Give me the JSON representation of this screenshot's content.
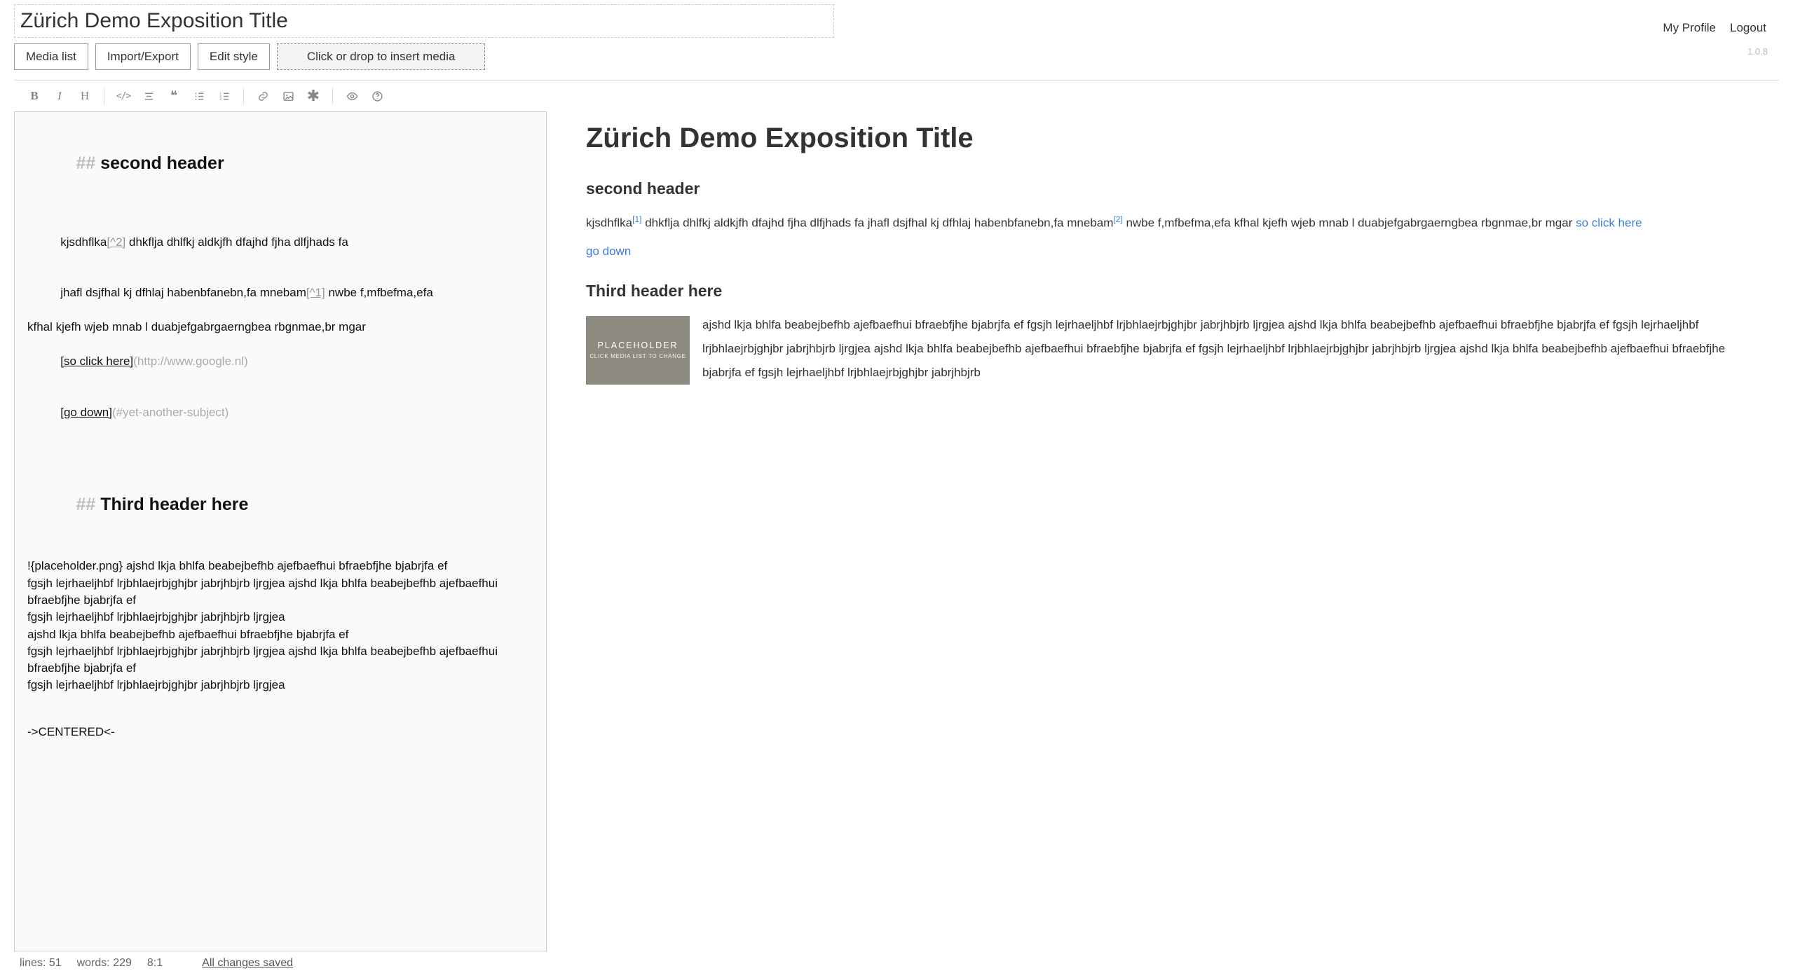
{
  "header": {
    "title_value": "Zürich Demo Exposition Title",
    "nav": {
      "profile": "My Profile",
      "logout": "Logout"
    },
    "version": "1.0.8",
    "buttons": {
      "media_list": "Media list",
      "import_export": "Import/Export",
      "edit_style": "Edit style"
    },
    "dropzone": "Click or drop to insert media"
  },
  "toolbar": {
    "bold": "B",
    "italic": "I",
    "header": "H",
    "code_open": "<",
    "code_close": "/>",
    "quote": "❝"
  },
  "editor": {
    "h2a_prefix": "## ",
    "h2a_text": "second header",
    "p1_l1a": "kjsdhflka",
    "p1_l1_fn": "[^2]",
    "p1_l1b": " dhkflja dhlfkj aldkjfh dfajhd fjha dlfjhads fa",
    "p1_l2a": "jhafl dsjfhal kj dfhlaj habenbfanebn,fa mnebam",
    "p1_l2_fn": "[^1]",
    "p1_l2b": " nwbe f,mfbefma,efa",
    "p1_l3": "kfhal kjefh wjeb mnab l duabjefgabrgaerngbea rbgnmae,br mgar",
    "link1_text": "[so click here]",
    "link1_url": "(http://www.google.nl)",
    "link2_text": "[go down]",
    "link2_url": "(#yet-another-subject)",
    "h2b_prefix": "## ",
    "h2b_text": "Third header here",
    "p2_l1": "!{placeholder.png} ajshd lkja bhlfa beabejbefhb ajefbaefhui bfraebfjhe bjabrjfa ef",
    "p2_l2": "fgsjh lejrhaeljhbf lrjbhlaejrbjghjbr jabrjhbjrb ljrgjea ajshd lkja bhlfa beabejbefhb ajefbaefhui bfraebfjhe bjabrjfa ef",
    "p2_l3": "fgsjh lejrhaeljhbf lrjbhlaejrbjghjbr jabrjhbjrb ljrgjea",
    "p2_l4": "ajshd lkja bhlfa beabejbefhb ajefbaefhui bfraebfjhe bjabrjfa ef",
    "p2_l5": "fgsjh lejrhaeljhbf lrjbhlaejrbjghjbr jabrjhbjrb ljrgjea ajshd lkja bhlfa beabejbefhb ajefbaefhui bfraebfjhe bjabrjfa ef",
    "p2_l6": "fgsjh lejrhaeljhbf lrjbhlaejrbjghjbr jabrjhbjrb ljrgjea",
    "p3": "->CENTERED<-"
  },
  "statusbar": {
    "lines_label": "lines:",
    "lines_value": "51",
    "words_label": "words:",
    "words_value": "229",
    "cursor": "8:1",
    "saved": "All changes saved"
  },
  "preview": {
    "title": "Zürich Demo Exposition Title",
    "h2a": "second header",
    "p1_a": "kjsdhflka",
    "p1_fn1": "[1]",
    "p1_b": " dhkflja dhlfkj aldkjfh dfajhd fjha dlfjhads fa jhafl dsjfhal kj dfhlaj habenbfanebn,fa mnebam",
    "p1_fn2": "[2]",
    "p1_c": " nwbe f,mfbefma,efa kfhal kjefh wjeb mnab l duabjefgabrgaerngbea rbgnmae,br mgar ",
    "link1": "so click here",
    "link2": "go down",
    "h2b": "Third header here",
    "placeholder_title": "PLACEHOLDER",
    "placeholder_sub": "CLICK MEDIA LIST TO CHANGE",
    "p2": "ajshd lkja bhlfa beabejbefhb ajefbaefhui bfraebfjhe bjabrjfa ef fgsjh lejrhaeljhbf lrjbhlaejrbjghjbr jabrjhbjrb ljrgjea ajshd lkja bhlfa beabejbefhb ajefbaefhui bfraebfjhe bjabrjfa ef fgsjh lejrhaeljhbf lrjbhlaejrbjghjbr jabrjhbjrb ljrgjea ajshd lkja bhlfa beabejbefhb ajefbaefhui bfraebfjhe bjabrjfa ef fgsjh lejrhaeljhbf lrjbhlaejrbjghjbr jabrjhbjrb ljrgjea ajshd lkja bhlfa beabejbefhb ajefbaefhui bfraebfjhe bjabrjfa ef fgsjh lejrhaeljhbf lrjbhlaejrbjghjbr jabrjhbjrb"
  }
}
